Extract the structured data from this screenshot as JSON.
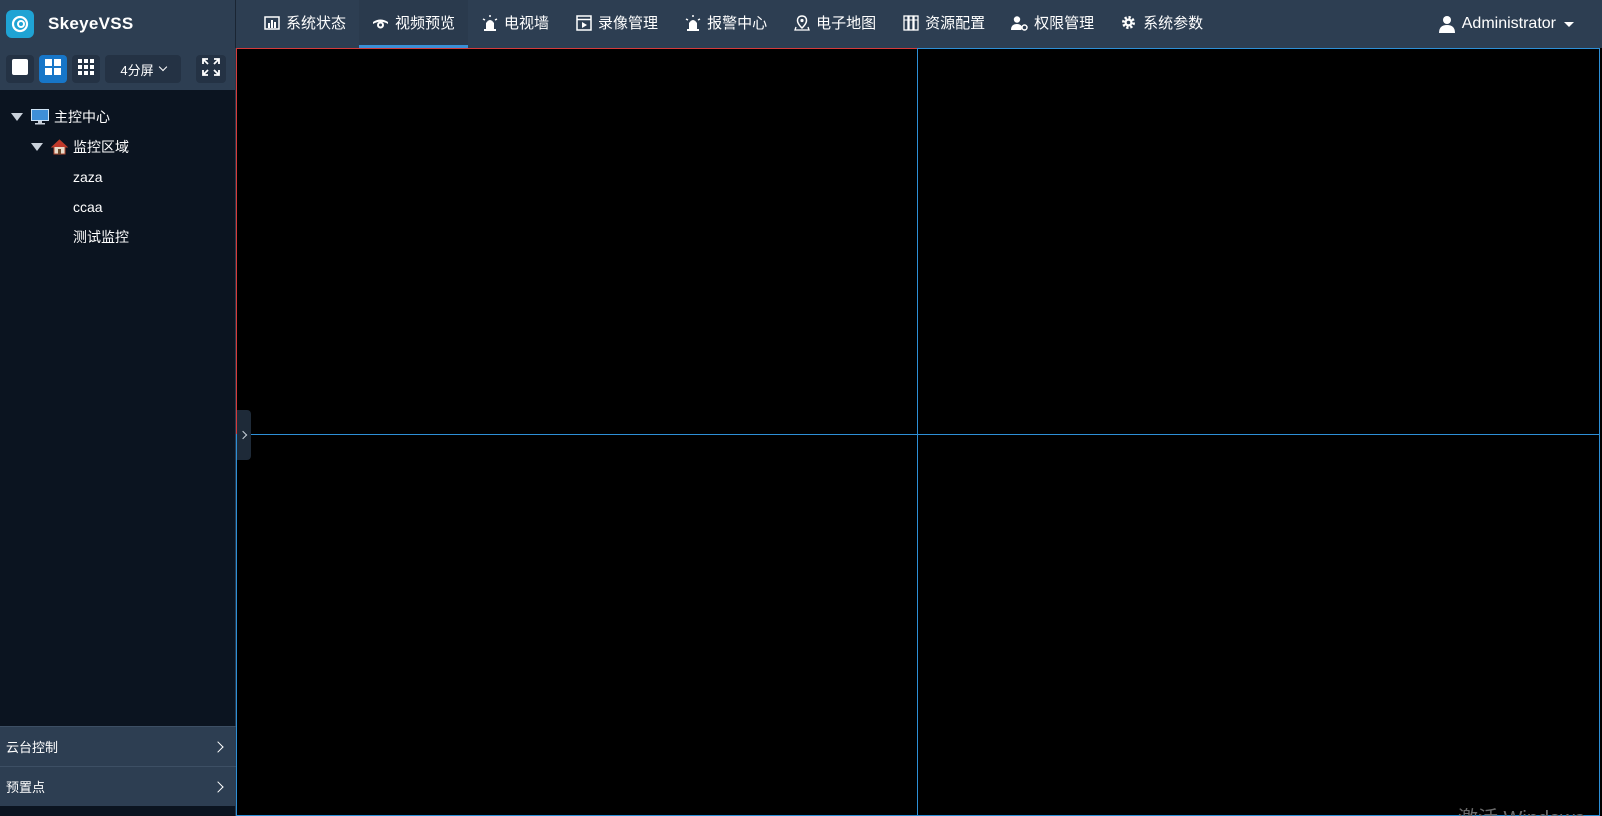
{
  "app": {
    "name": "SkeyeVSS"
  },
  "nav": {
    "items": [
      {
        "label": "系统状态",
        "icon": "bar-chart-icon"
      },
      {
        "label": "视频预览",
        "icon": "camera-dome-icon"
      },
      {
        "label": "电视墙",
        "icon": "alarm-light-icon"
      },
      {
        "label": "录像管理",
        "icon": "film-icon"
      },
      {
        "label": "报警中心",
        "icon": "siren-icon"
      },
      {
        "label": "电子地图",
        "icon": "map-pin-icon"
      },
      {
        "label": "资源配置",
        "icon": "server-rack-icon"
      },
      {
        "label": "权限管理",
        "icon": "user-gear-icon"
      },
      {
        "label": "系统参数",
        "icon": "gear-icon"
      }
    ],
    "active": "视频预览"
  },
  "user": {
    "name": "Administrator"
  },
  "toolbar": {
    "split_label": "4分屏"
  },
  "tree": {
    "root": "主控中心",
    "area": "监控区域",
    "devices": [
      "zaza",
      "ccaa",
      "测试监控"
    ]
  },
  "panels": {
    "ptz": "云台控制",
    "preset": "预置点"
  },
  "watermark": "激活 Windows",
  "colors": {
    "accent": "#1776c8",
    "active_border": "#d63a3a",
    "idle_border": "#2d8fd6"
  }
}
